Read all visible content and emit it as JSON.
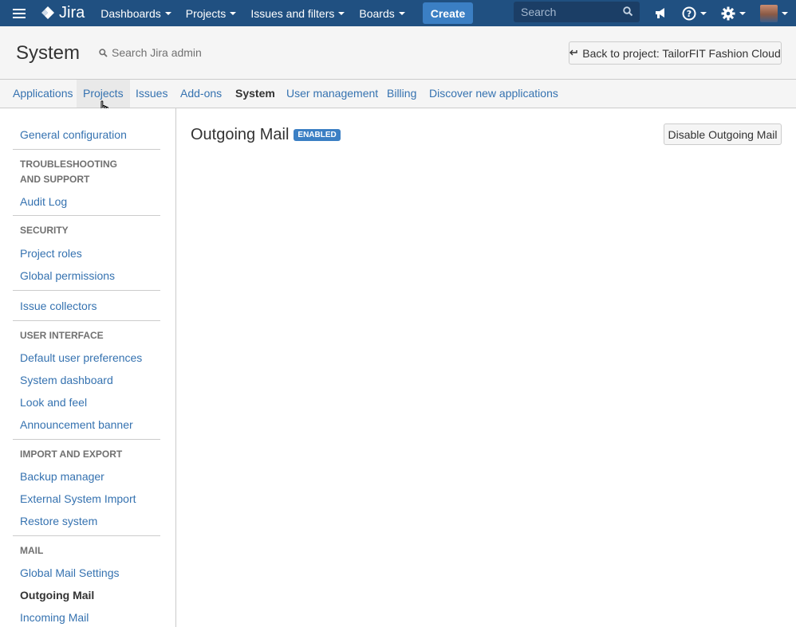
{
  "topnav": {
    "logo_text": "Jira",
    "items": [
      {
        "label": "Dashboards"
      },
      {
        "label": "Projects"
      },
      {
        "label": "Issues and filters"
      },
      {
        "label": "Boards"
      }
    ],
    "create_label": "Create",
    "search_placeholder": "Search",
    "icons": [
      "menu-icon",
      "jira-logo-icon",
      "search-icon",
      "megaphone-icon",
      "help-icon",
      "gear-icon",
      "avatar"
    ],
    "colors": {
      "bar": "#205081",
      "create": "#3b7fc4",
      "search_bg": "#1b3e66"
    }
  },
  "admin_header": {
    "title": "System",
    "search_placeholder": "Search Jira admin",
    "back_button": "Back to project: TailorFIT Fashion Cloud"
  },
  "tabs": [
    {
      "label": "Applications"
    },
    {
      "label": "Projects"
    },
    {
      "label": "Issues"
    },
    {
      "label": "Add-ons"
    },
    {
      "label": "System"
    },
    {
      "label": "User management"
    },
    {
      "label": "Billing"
    },
    {
      "label": "Discover new applications"
    }
  ],
  "active_tab": "System",
  "hovered_tab": "Projects",
  "sidebar": {
    "general_configuration": "General configuration",
    "troubleshooting_heading": "TROUBLESHOOTING AND SUPPORT",
    "audit_log": "Audit Log",
    "security_heading": "SECURITY",
    "project_roles": "Project roles",
    "global_permissions": "Global permissions",
    "issue_collectors": "Issue collectors",
    "user_interface_heading": "USER INTERFACE",
    "default_user_preferences": "Default user preferences",
    "system_dashboard": "System dashboard",
    "look_and_feel": "Look and feel",
    "announcement_banner": "Announcement banner",
    "import_export_heading": "IMPORT AND EXPORT",
    "backup_manager": "Backup manager",
    "external_system_import": "External System Import",
    "restore_system": "Restore system",
    "mail_heading": "MAIL",
    "global_mail_settings": "Global Mail Settings",
    "outgoing_mail": "Outgoing Mail",
    "incoming_mail": "Incoming Mail"
  },
  "main": {
    "title": "Outgoing Mail",
    "status_lozenge": "ENABLED",
    "disable_button": "Disable Outgoing Mail"
  }
}
